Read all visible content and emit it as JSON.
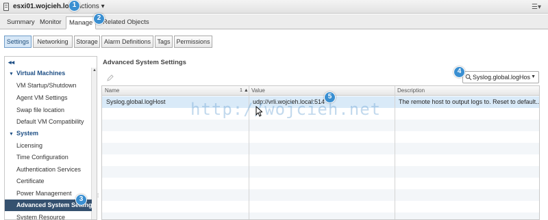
{
  "header": {
    "host_title": "esxi01.wojcieh.local",
    "actions_label": "Actions ▾",
    "menu_icon": "list-icon"
  },
  "main_tabs": [
    {
      "label": "Summary",
      "active": false
    },
    {
      "label": "Monitor",
      "active": false
    },
    {
      "label": "Manage",
      "active": true
    },
    {
      "label": "Related Objects",
      "active": false
    }
  ],
  "sub_tabs": [
    {
      "label": "Settings",
      "active": true
    },
    {
      "label": "Networking",
      "active": false
    },
    {
      "label": "Storage",
      "active": false
    },
    {
      "label": "Alarm Definitions",
      "active": false
    },
    {
      "label": "Tags",
      "active": false
    },
    {
      "label": "Permissions",
      "active": false
    }
  ],
  "sidebar": {
    "collapse_label": "◂◂",
    "items": [
      {
        "label": "Virtual Machines",
        "type": "group"
      },
      {
        "label": "VM Startup/Shutdown",
        "type": "item"
      },
      {
        "label": "Agent VM Settings",
        "type": "item"
      },
      {
        "label": "Swap file location",
        "type": "item"
      },
      {
        "label": "Default VM Compatibility",
        "type": "item"
      },
      {
        "label": "System",
        "type": "group"
      },
      {
        "label": "Licensing",
        "type": "item"
      },
      {
        "label": "Time Configuration",
        "type": "item"
      },
      {
        "label": "Authentication Services",
        "type": "item"
      },
      {
        "label": "Certificate",
        "type": "item"
      },
      {
        "label": "Power Management",
        "type": "item"
      },
      {
        "label": "Advanced System Settings",
        "type": "item",
        "selected": true
      },
      {
        "label": "System Resource",
        "type": "item"
      }
    ]
  },
  "panel": {
    "title": "Advanced System Settings",
    "filter_value": "Syslog.global.logHos"
  },
  "table": {
    "columns": [
      "Name",
      "Value",
      "Description"
    ],
    "sort_indicator": "1 ▲",
    "rows": [
      {
        "name": "Syslog.global.logHost",
        "value": "udp://vrli.wojcieh.local:514",
        "description": "The remote host to output logs to. Reset to default..."
      }
    ]
  },
  "annotations": [
    "1",
    "2",
    "3",
    "4",
    "5"
  ],
  "watermark": "http://wojcieh.net",
  "colors": {
    "accent": "#3a8fd1",
    "selected_nav": "#35516f",
    "selected_row": "#d9eaf8",
    "group_text": "#1e4f85"
  }
}
